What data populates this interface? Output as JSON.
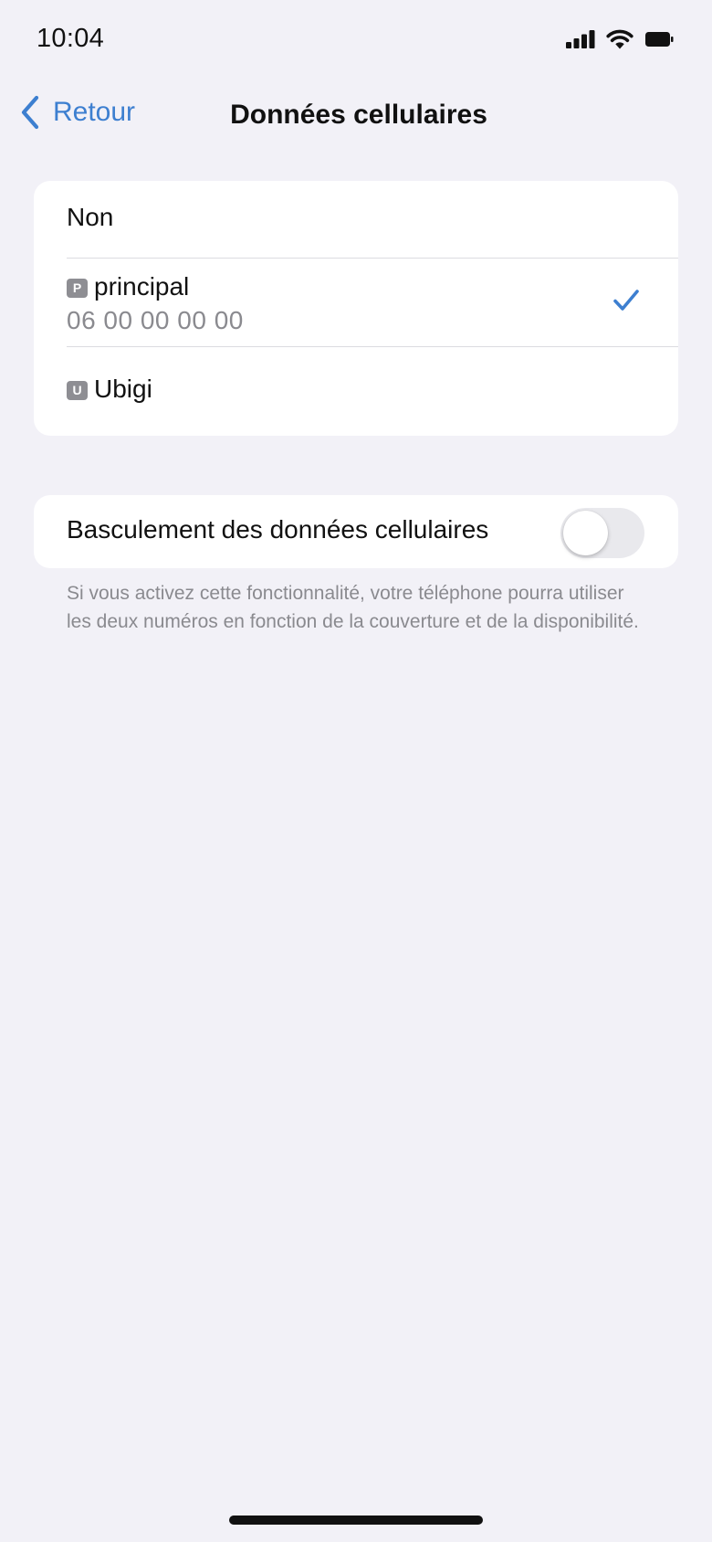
{
  "status_bar": {
    "time": "10:04",
    "icons": [
      "cellular-signal-icon",
      "wifi-icon",
      "battery-icon"
    ]
  },
  "nav": {
    "back_label": "Retour",
    "back_icon": "chevron-left-icon",
    "title": "Données cellulaires",
    "accent_color": "#3d7fd0"
  },
  "options": [
    {
      "label": "Non"
    },
    {
      "badge": "P",
      "label": "principal",
      "number": "06 00 00 00 00",
      "selected": true
    },
    {
      "badge": "U",
      "label": "Ubigi"
    }
  ],
  "switching": {
    "label": "Basculement des données cellulaires",
    "enabled": false,
    "footnote": "Si vous activez cette fonctionnalité, votre téléphone pourra utiliser les deux numéros en fonction de la couverture et de la disponibilité."
  }
}
